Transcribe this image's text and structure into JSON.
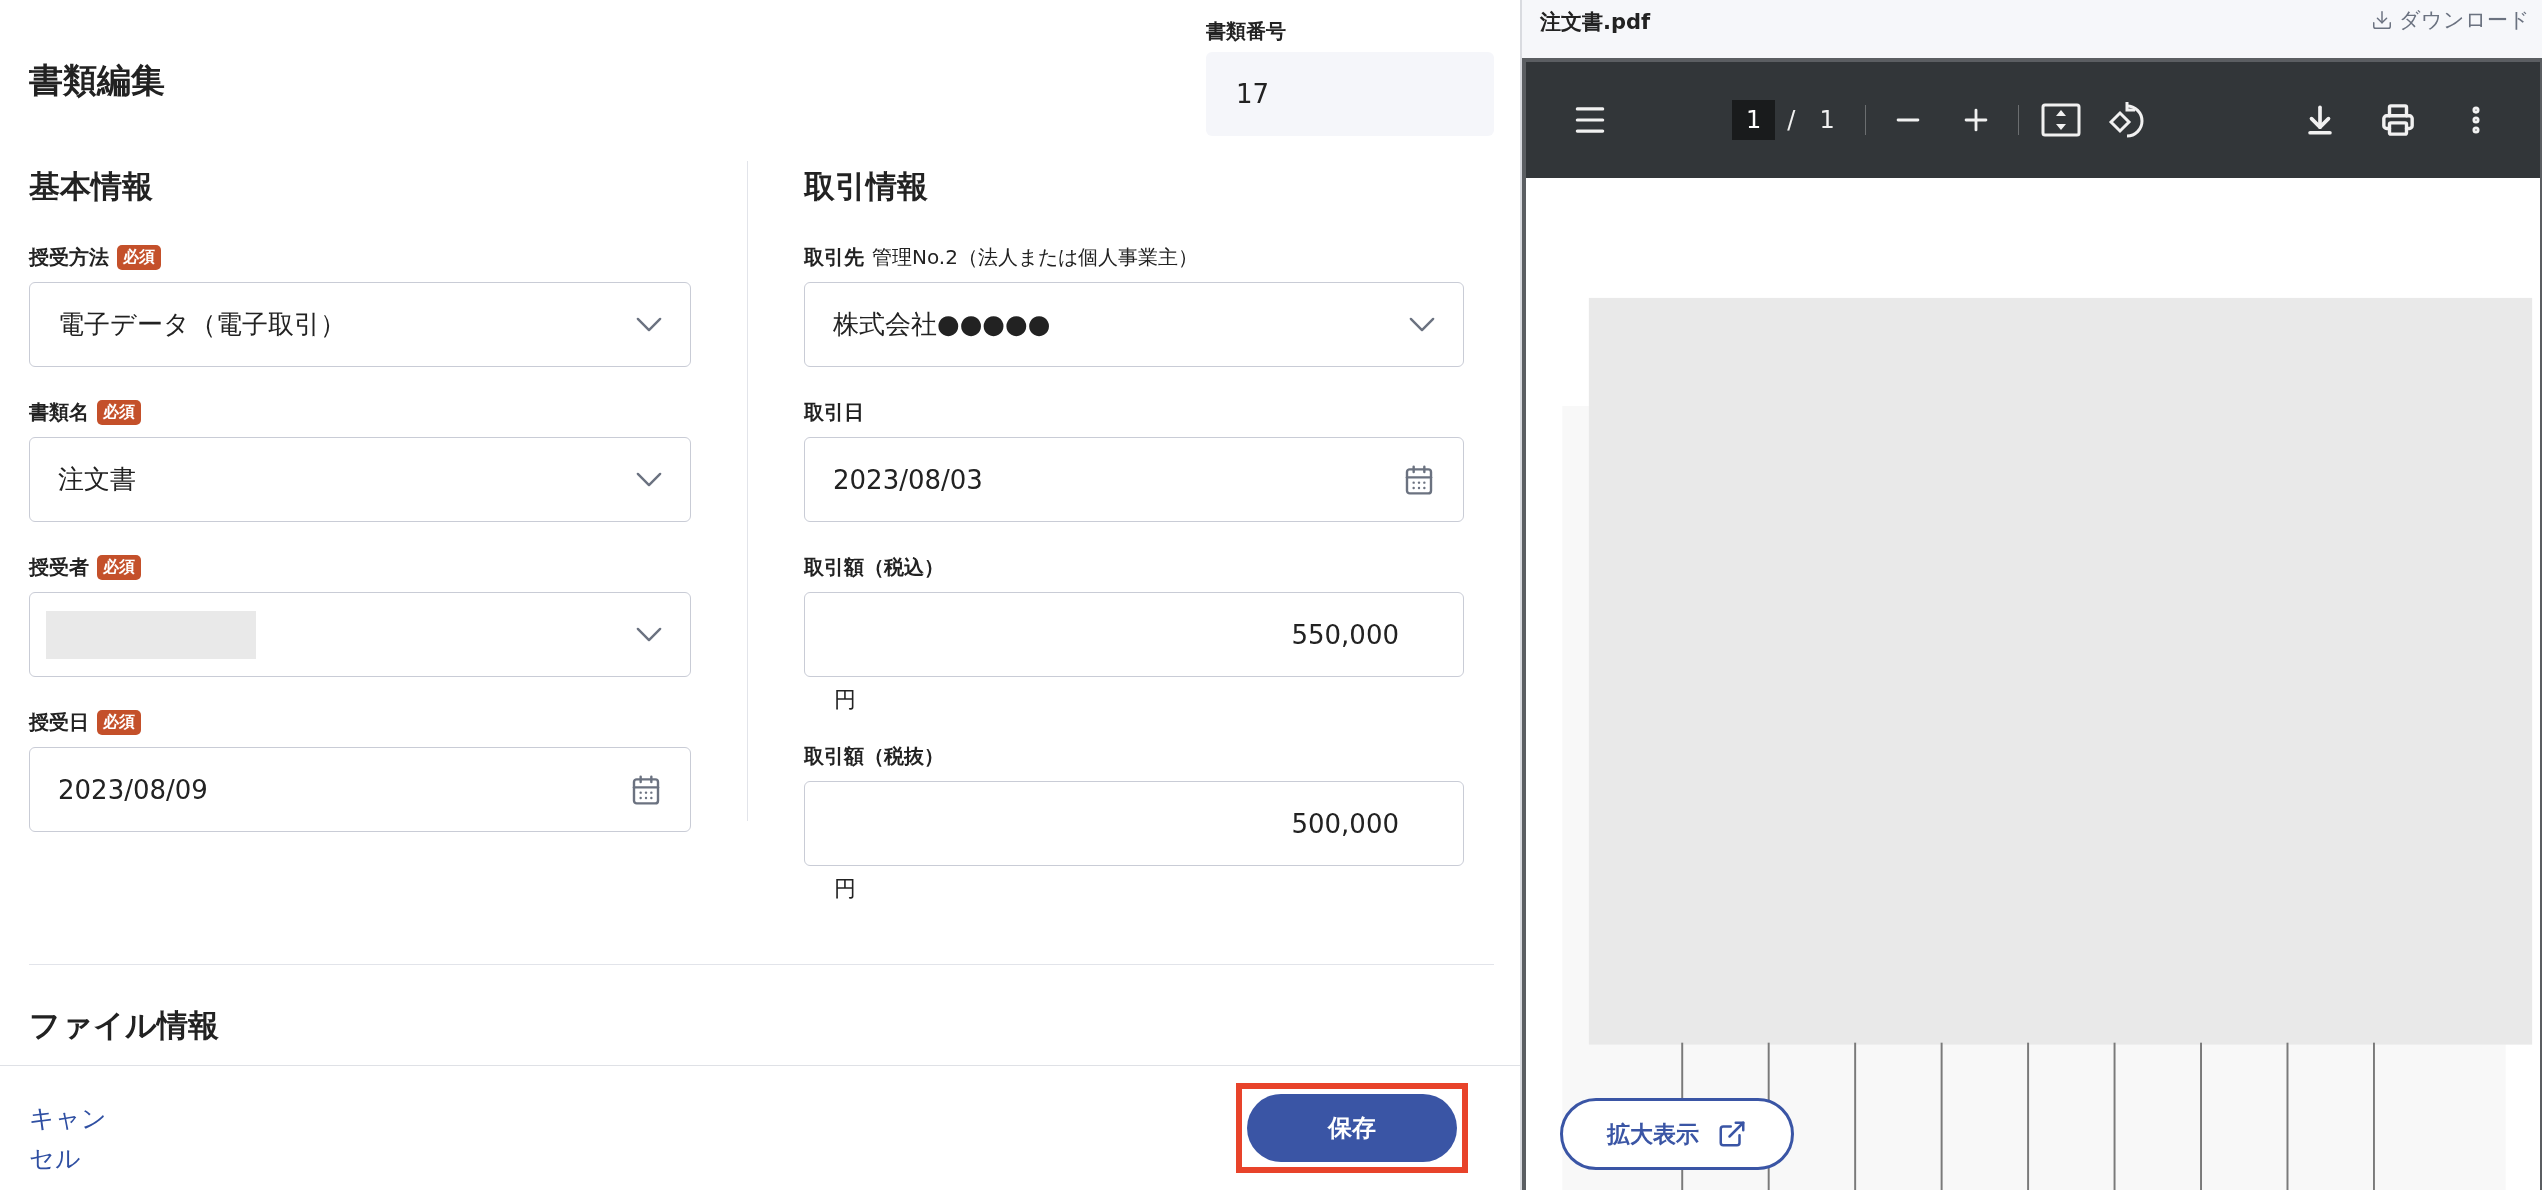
{
  "page_title": "書類編集",
  "document_number": {
    "label": "書類番号",
    "value": "17"
  },
  "sections": [
    {
      "title": "基本情報",
      "fields": [
        {
          "kind": "select",
          "label": "授受方法",
          "badge": "必須",
          "value": "電子データ（電子取引）"
        },
        {
          "kind": "select",
          "label": "書類名",
          "badge": "必須",
          "value": "注文書"
        },
        {
          "kind": "select",
          "label": "授受者",
          "badge": "必須",
          "redacted": true
        },
        {
          "kind": "date",
          "label": "授受日",
          "badge": "必須",
          "value": "2023/08/09"
        }
      ]
    },
    {
      "title": "取引情報",
      "fields": [
        {
          "kind": "select",
          "label": "取引先",
          "note": "管理No.2（法人または個人事業主）",
          "value": "株式会社●●●●●"
        },
        {
          "kind": "date",
          "label": "取引日",
          "value": "2023/08/03"
        },
        {
          "kind": "amount",
          "label": "取引額（税込）",
          "value": "550,000",
          "unit": "円"
        },
        {
          "kind": "amount",
          "label": "取引額（税抜）",
          "value": "500,000",
          "unit": "円"
        }
      ]
    }
  ],
  "file_section": {
    "title": "ファイル情報"
  },
  "footer": {
    "cancel": "キャンセル",
    "save": "保存",
    "save_highlighted": true
  },
  "preview": {
    "file_name": "注文書.pdf",
    "download": "ダウンロード",
    "page": "1",
    "separator": "/",
    "total": "1",
    "expand_button": "拡大表示"
  }
}
